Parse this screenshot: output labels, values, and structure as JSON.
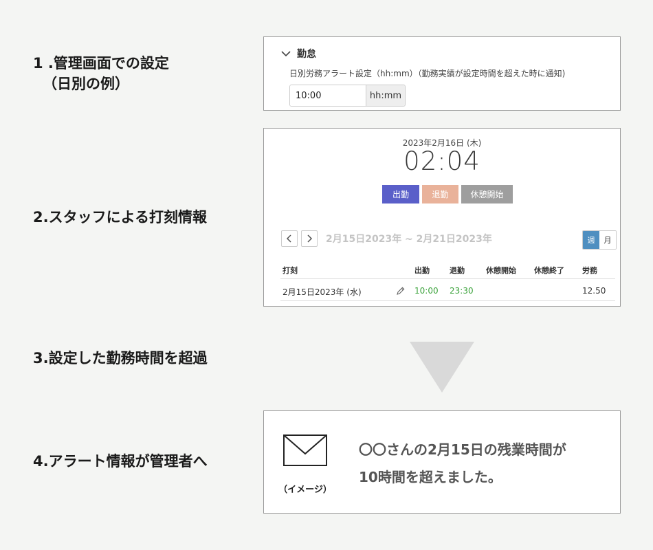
{
  "steps": [
    {
      "line1": "1 .管理画面での設定",
      "line2": "（日別の例）"
    },
    {
      "line1": "2.スタッフによる打刻情報"
    },
    {
      "line1": "3.設定した勤務時間を超過"
    },
    {
      "line1": "4.アラート情報が管理者へ"
    }
  ],
  "settings_panel": {
    "section_title": "勤怠",
    "field_label": "日別労務アラート設定（hh:mm）（勤務実績が設定時間を超えた時に通知)",
    "time_value": "10:00",
    "unit": "hh:mm"
  },
  "punch_panel": {
    "date": "2023年2月16日 (木)",
    "time": "02:04",
    "buttons": {
      "clock_in": "出勤",
      "clock_out": "退勤",
      "break_start": "休憩開始"
    },
    "button_colors": {
      "clock_in": "#5a5fc9",
      "clock_out": "#e9b29a",
      "break_start": "#9e9e9e"
    },
    "date_range": "2月15日2023年 ~ 2月21日2023年",
    "view_toggle": {
      "week": "週",
      "month": "月"
    },
    "table": {
      "headers": [
        "打刻",
        "出勤",
        "退勤",
        "休憩開始",
        "休憩終了",
        "労務"
      ],
      "rows": [
        {
          "date": "2月15日2023年 (水)",
          "in": "10:00",
          "out": "23:30",
          "break_start": "",
          "break_end": "",
          "hours": "12.50"
        }
      ]
    }
  },
  "notification_panel": {
    "icon": "envelope-icon",
    "caption": "（イメージ）",
    "message_line1": "〇〇さんの2月15日の残業時間が",
    "message_line2": "10時間を超えました。"
  }
}
